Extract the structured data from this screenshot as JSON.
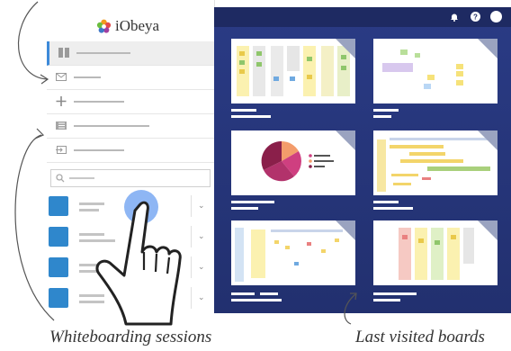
{
  "brand": {
    "name": "iObeya"
  },
  "annotations": {
    "left": "Whiteboarding sessions",
    "right": "Last visited boards"
  },
  "colors": {
    "panel": "#26347a",
    "accent": "#3d8ad9",
    "session_tile": "#2f87cc"
  },
  "topbar_icons": [
    "bell-icon",
    "help-icon",
    "avatar"
  ],
  "nav_icons": [
    "boards-icon",
    "mail-icon",
    "plus-icon",
    "list-icon",
    "import-icon"
  ],
  "search_icon": "search-icon"
}
